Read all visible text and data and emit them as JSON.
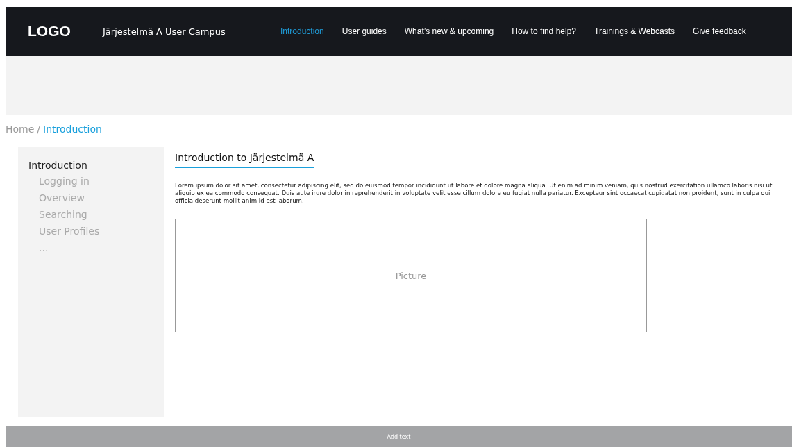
{
  "header": {
    "logo": "LOGO",
    "site_title": "Järjestelmä A User Campus",
    "nav": [
      {
        "label": "Introduction",
        "selected": true
      },
      {
        "label": "User guides",
        "selected": false
      },
      {
        "label": "What’s new & upcoming",
        "selected": false
      },
      {
        "label": "How to find help?",
        "selected": false
      },
      {
        "label": "Trainings & Webcasts",
        "selected": false
      },
      {
        "label": "Give feedback",
        "selected": false
      }
    ]
  },
  "breadcrumb": [
    {
      "label": "Home",
      "selected": false
    },
    {
      "label": "Introduction",
      "selected": true
    }
  ],
  "breadcrumb_separator": "/",
  "sidebar": {
    "items": [
      {
        "label": "Introduction",
        "children": [
          {
            "label": "Logging in"
          },
          {
            "label": "Overview"
          },
          {
            "label": "Searching"
          },
          {
            "label": "User Profiles"
          },
          {
            "label": "..."
          }
        ]
      }
    ]
  },
  "content": {
    "heading": "Introduction to Järjestelmä A",
    "body": "Lorem ipsum dolor sit amet, consectetur adipiscing elit, sed do eiusmod tempor incididunt ut labore et dolore magna aliqua. Ut enim ad minim veniam, quis nostrud exercitation ullamco laboris nisi ut aliquip ex ea commodo consequat. Duis aute irure dolor in reprehenderit in voluptate velit esse cillum dolore eu fugiat nulla pariatur. Excepteur sint occaecat cupidatat non proident, sunt in culpa qui officia deserunt mollit anim id est laborum.",
    "picture_label": "Picture"
  },
  "footer": {
    "text": "Add text"
  }
}
